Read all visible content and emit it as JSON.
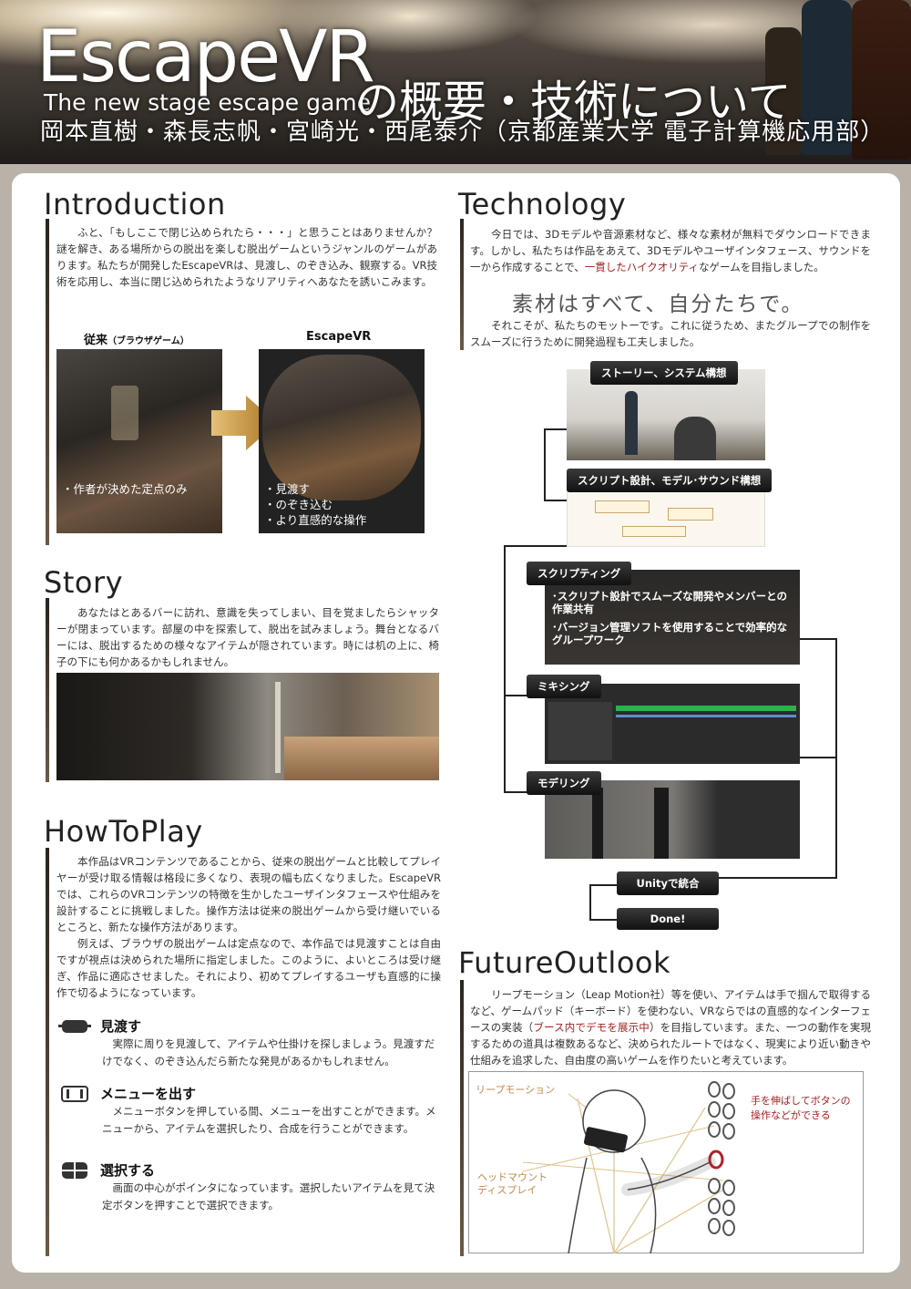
{
  "header": {
    "title": "EscapeVR",
    "subtitle": "The new stage escape game",
    "title_jp": "の概要・技術について",
    "authors": "岡本直樹・森長志帆・宮崎光・西尾泰介（京都産業大学 電子計算機応用部）"
  },
  "introduction": {
    "title": "Introduction",
    "text": "ふと、「もしここで閉じ込められたら・・・」と思うことはありませんか？謎を解き、ある場所からの脱出を楽しむ脱出ゲームというジャンルのゲームがあります。私たちが開発したEscapeVRは、見渡し、のぞき込み、観察する。VR技術を応用し、本当に閉じ込められたようなリアリティへあなたを誘いこみます。",
    "left_caption": "従来",
    "left_caption_sub": "（ブラウザゲーム）",
    "right_caption": "EscapeVR",
    "left_bullets": [
      "・作者が決めた定点のみ"
    ],
    "right_bullets": [
      "・見渡す",
      "・のぞき込む",
      "・より直感的な操作"
    ]
  },
  "story": {
    "title": "Story",
    "text": "あなたはとあるバーに訪れ、意識を失ってしまい、目を覚ましたらシャッターが閉まっています。部屋の中を探索して、脱出を試みましょう。舞台となるバーには、脱出するための様々なアイテムが隠されています。時には机の上に、椅子の下にも何かあるかもしれません。"
  },
  "howtoplay": {
    "title": "HowToPlay",
    "text1": "本作品はVRコンテンツであることから、従来の脱出ゲームと比較してプレイヤーが受け取る情報は格段に多くなり、表現の幅も広くなりました。EscapeVRでは、これらのVRコンテンツの特徴を生かしたユーザインタフェースや仕組みを設計することに挑戦しました。操作方法は従来の脱出ゲームから受け継いでいるところと、新たな操作方法があります。",
    "text2": "例えば、ブラウザの脱出ゲームは定点なので、本作品では見渡すことは自由ですが視点は決められた場所に指定しました。このように、よいところは受け継ぎ、作品に適応させました。それにより、初めてプレイするユーザも直感的に操作で切るようになっています。",
    "items": [
      {
        "label": "見渡す",
        "icon": "hmd-icon",
        "text": "実際に周りを見渡して、アイテムや仕掛けを探しましょう。見渡すだけでなく、のぞき込んだら新たな発見があるかもしれません。"
      },
      {
        "label": "メニューを出す",
        "icon": "menu-icon",
        "text": "メニューボタンを押している間、メニューを出すことができます。メニューから、アイテムを選択したり、合成を行うことができます。"
      },
      {
        "label": "選択する",
        "icon": "crosshair-icon",
        "text": "画面の中心がポインタになっています。選択したいアイテムを見て決定ボタンを押すことで選択できます。"
      }
    ]
  },
  "technology": {
    "title": "Technology",
    "text1a": "今日では、3Dモデルや音源素材など、様々な素材が無料でダウンロードできます。しかし、私たちは作品をあえて、3Dモデルやユーザインタフェース、サウンドを一から作成することで、",
    "text1_red": "一貫したハイクオリティ",
    "text1b": "なゲームを目指しました。",
    "motto": "素材はすべて、自分たちで。",
    "text2": "それこそが、私たちのモットーです。これに従うため、またグループでの制作をスムーズに行うために開発過程も工夫しました。",
    "steps": [
      "ストーリー、システム構想",
      "スクリプト設計、モデル･サウンド構想",
      "スクリプティング",
      "ミキシング",
      "モデリング",
      "Unityで統合",
      "Done!"
    ],
    "scripting_bullets": [
      "･スクリプト設計でスムーズな開発やメンバーとの作業共有",
      "･バージョン管理ソフトを使用することで効率的なグループワーク"
    ]
  },
  "future": {
    "title": "FutureOutlook",
    "text_a": "リープモーション（Leap Motion社）等を使い、アイテムは手で掴んで取得するなど、ゲームパッド（キーボード）を使わない、VRならではの直感的なインターフェースの実装（",
    "text_red": "ブース内でデモを展示中",
    "text_b": "）を目指しています。また、一つの動作を実現するための道具は複数あるなど、決められたルートではなく、現実により近い動きや仕組みを追求した、自由度の高いゲームを作りたいと考えています。",
    "label_leap": "リープモーション",
    "label_hmd": "ヘッドマウント\nディスプレイ",
    "label_hand": "手を伸ばしてボタンの\n操作などができる"
  },
  "colors": {
    "accent_red": "#a31f1f",
    "panel": "#ffffff",
    "frame": "#b9b2a9"
  }
}
